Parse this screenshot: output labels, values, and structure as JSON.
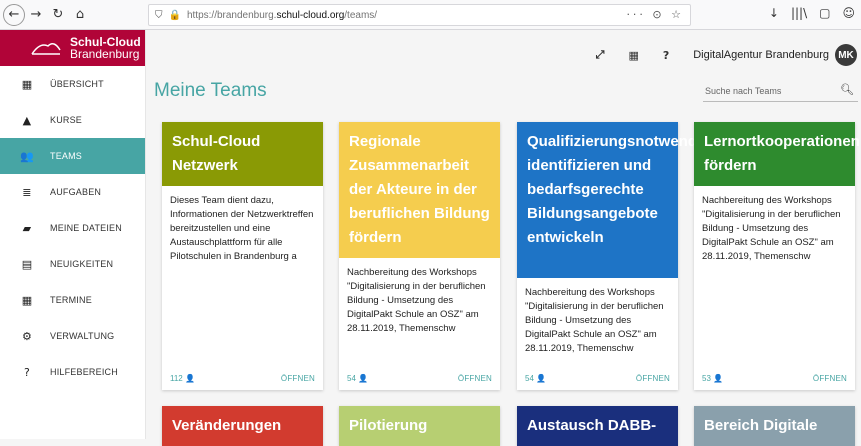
{
  "browser": {
    "url_prefix": "https://brandenburg.",
    "url_host": "schul-cloud.org",
    "url_suffix": "/teams/",
    "url_right": "··· ⊙ ☆",
    "right_icons": [
      "↓",
      "|||\\",
      "▢",
      "☺"
    ]
  },
  "logo": {
    "title": "Schul-Cloud",
    "sub": "Brandenburg"
  },
  "sidebar": {
    "items": [
      {
        "label": "ÜBERSICHT",
        "icon": "▦"
      },
      {
        "label": "KURSE",
        "icon": "▲"
      },
      {
        "label": "TEAMS",
        "icon": "👥",
        "active": true
      },
      {
        "label": "AUFGABEN",
        "icon": "≣"
      },
      {
        "label": "MEINE DATEIEN",
        "icon": "▰"
      },
      {
        "label": "NEUIGKEITEN",
        "icon": "▤"
      },
      {
        "label": "TERMINE",
        "icon": "▦"
      },
      {
        "label": "VERWALTUNG",
        "icon": "⚙"
      },
      {
        "label": "HILFEBEREICH",
        "icon": "?"
      }
    ]
  },
  "header": {
    "user": "DigitalAgentur Brandenburg",
    "avatar": "MK",
    "icons": [
      "⤢",
      "▦",
      "?"
    ]
  },
  "main": {
    "title": "Meine Teams",
    "search_placeholder": "Suche nach Teams",
    "open_label": "ÖFFNEN",
    "cards": [
      {
        "title": "Schul-Cloud Netzwerk",
        "color": "#8a9a05",
        "desc": "Dieses Team dient dazu, Informationen der Netzwerktreffen bereitzustellen und eine Austauschplattform für alle Pilotschulen in Brandenburg a",
        "count": "112"
      },
      {
        "title": "Regionale Zusammenarbeit der Akteure in der beruflichen Bildung fördern",
        "color": "#f5cd4e",
        "desc": "Nachbereitung des Workshops \"Digitalisierung in der beruflichen Bildung - Umsetzung des DigitalPakt Schule an OSZ\" am 28.11.2019, Themenschw",
        "count": "54"
      },
      {
        "title": "Qualifizierungsnotwendigkeiten identifizieren und bedarfsgerechte Bildungsangebote entwickeln",
        "color": "#1e74c6",
        "desc": "Nachbereitung des Workshops \"Digitalisierung in der beruflichen Bildung - Umsetzung des DigitalPakt Schule an OSZ\" am 28.11.2019, Themenschw",
        "count": "54"
      },
      {
        "title": "Lernortkooperationen fördern",
        "color": "#2e8b2e",
        "desc": "Nachbereitung des Workshops \"Digitalisierung in der beruflichen Bildung - Umsetzung des DigitalPakt Schule an OSZ\" am 28.11.2019, Themenschw",
        "count": "53"
      },
      {
        "title": "Veränderungen",
        "color": "#d23b2f"
      },
      {
        "title": "Pilotierung",
        "color": "#b7cf72"
      },
      {
        "title": "Austausch DABB-",
        "color": "#1a2f7d"
      },
      {
        "title": "Bereich Digitale",
        "color": "#8aa0ac"
      }
    ]
  }
}
